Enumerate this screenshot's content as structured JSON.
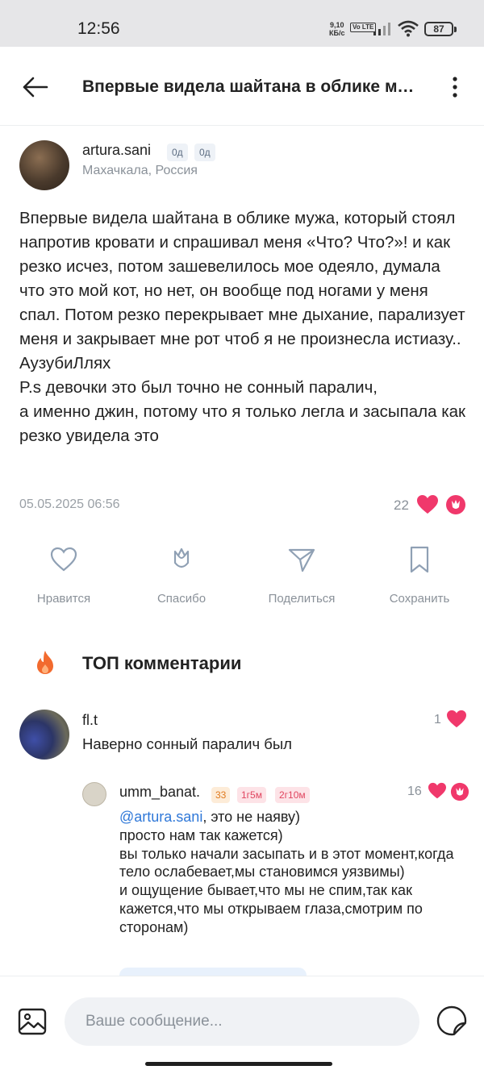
{
  "status_bar": {
    "time": "12:56",
    "net_speed": "9,10",
    "net_unit": "КБ/с",
    "volte": "Vo LTE",
    "battery": "87"
  },
  "header": {
    "title": "Впервые видела шайтана в облике мужа, который стоял напротив кровати",
    "back_icon": "arrow-left-icon",
    "more_icon": "more-vertical-icon"
  },
  "post": {
    "author": "artura.sani",
    "badge1": "0д",
    "badge2": "0д",
    "location": "Махачкала, Россия",
    "text": "Впервые видела шайтана в облике мужа, который стоял напротив кровати и спрашивал меня «Что? Что?»! и как резко исчез, потом зашевелилось мое одеяло, думала что это мой кот, но нет, он вообще под ногами у меня спал. Потом резко перекрывает мне дыхание, парализует меня и закрывает мне рот чтоб я не произнесла истиазу..\nАузубиЛлях\nP.s девочки это был точно не сонный паралич,\nа именно джин, потому что я только легла и засыпала как резко увидела это",
    "date": "05.05.2025 06:56",
    "like_count": "22"
  },
  "actions": {
    "like_label": "Нравится",
    "thanks_label": "Спасибо",
    "share_label": "Поделиться",
    "save_label": "Сохранить"
  },
  "top_comments": {
    "title": "ТОП комментарии"
  },
  "comments": [
    {
      "author": "fl.t",
      "text": "Наверно сонный паралич был",
      "likes": "1"
    },
    {
      "author": "umm_banat.",
      "badge_level": "33",
      "badge_a": "1г5м",
      "badge_b": "2г10м",
      "likes": "16",
      "mention": "@artura.sani",
      "text_after_mention": ", это не наяву)\nпросто нам так кажется)\nвы только начали засыпать и в этот момент,когда тело ослабевает,мы становимся уязвимы)\nи ощущение бывает,что мы не спим,так как кажется,что мы открываем глаза,смотрим по сторонам)"
    }
  ],
  "composer": {
    "placeholder": "Ваше сообщение..."
  },
  "colors": {
    "accent_pink": "#f0386b",
    "mention_blue": "#2f78d8",
    "fire_orange": "#f26a2e"
  }
}
